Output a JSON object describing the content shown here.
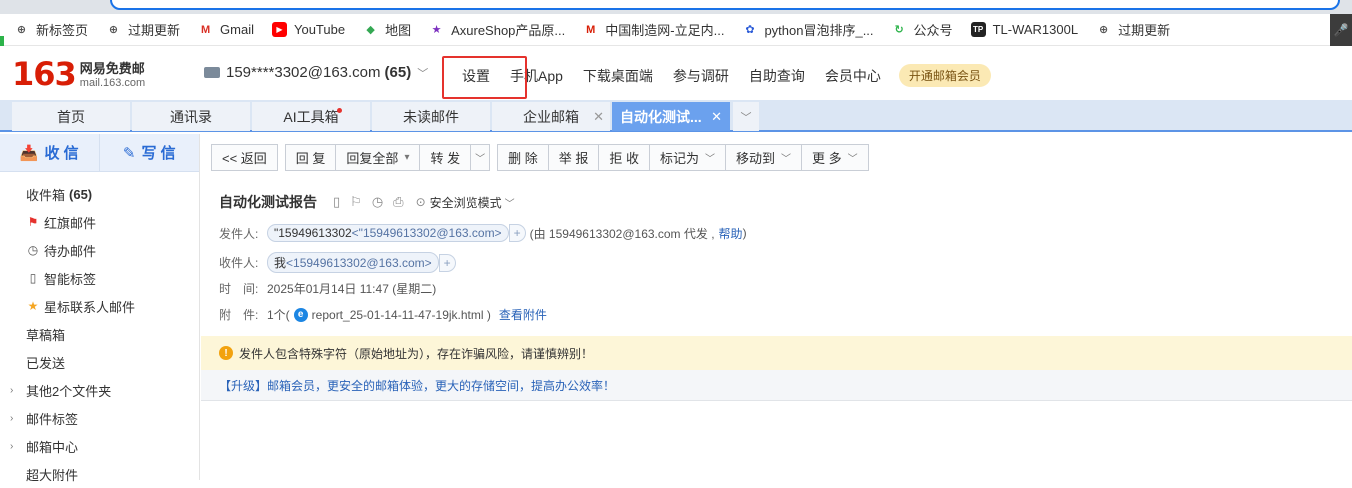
{
  "browser": {
    "bookmarks": [
      {
        "label": "新标签页",
        "icon": "globe-icon",
        "color": "#555555"
      },
      {
        "label": "过期更新",
        "icon": "globe-icon",
        "color": "#555555"
      },
      {
        "label": "Gmail",
        "icon": "gmail-icon",
        "color": "#d93025"
      },
      {
        "label": "YouTube",
        "icon": "youtube-icon",
        "color": "#ff0000"
      },
      {
        "label": "地图",
        "icon": "maps-icon",
        "color": "#34a853"
      },
      {
        "label": "AxureShop产品原...",
        "icon": "star-icon",
        "color": "#7b2fbf"
      },
      {
        "label": "中国制造网-立足内...",
        "icon": "mic-logo-icon",
        "color": "#d81e06"
      },
      {
        "label": "python冒泡排序_...",
        "icon": "paw-icon",
        "color": "#2b5bd7"
      },
      {
        "label": "公众号",
        "icon": "swirl-icon",
        "color": "#2cb34a"
      },
      {
        "label": "TL-WAR1300L",
        "icon": "tp-link-icon",
        "color": "#222222"
      },
      {
        "label": "过期更新",
        "icon": "globe-icon",
        "color": "#555555"
      }
    ]
  },
  "header": {
    "logo_num": "163",
    "logo_title": "网易免费邮",
    "logo_domain": "mail.163.com",
    "account": "159****3302@163.com",
    "account_count": "(65)",
    "nav": [
      "设置",
      "手机App",
      "下载桌面端",
      "参与调研",
      "自助查询",
      "会员中心"
    ],
    "vip": "开通邮箱会员",
    "highlight_color": "#e5322d"
  },
  "tabs": [
    {
      "label": "首页"
    },
    {
      "label": "通讯录"
    },
    {
      "label": "AI工具箱"
    },
    {
      "label": "未读邮件"
    },
    {
      "label": "企业邮箱"
    },
    {
      "label": "自动化测试..."
    }
  ],
  "sidebar": {
    "receive": "收 信",
    "write": "写 信",
    "folders": [
      {
        "label": "收件箱",
        "count": "(65)",
        "icon": ""
      },
      {
        "label": "红旗邮件",
        "count": "",
        "icon": "red-flag-icon"
      },
      {
        "label": "待办邮件",
        "count": "",
        "icon": "clock-icon"
      },
      {
        "label": "智能标签",
        "count": "",
        "icon": "tag-icon"
      },
      {
        "label": "星标联系人邮件",
        "count": "",
        "icon": "star-icon"
      },
      {
        "label": "草稿箱",
        "count": "",
        "icon": ""
      },
      {
        "label": "已发送",
        "count": "",
        "icon": ""
      },
      {
        "label": "其他2个文件夹",
        "count": "",
        "icon": "expand"
      },
      {
        "label": "邮件标签",
        "count": "",
        "icon": "expand"
      },
      {
        "label": "邮箱中心",
        "count": "",
        "icon": "expand"
      },
      {
        "label": "超大附件",
        "count": "",
        "icon": ""
      }
    ]
  },
  "toolbar": {
    "back": "<< 返回",
    "reply": "回 复",
    "reply_all": "回复全部",
    "forward": "转 发",
    "delete": "删 除",
    "report": "举 报",
    "reject": "拒 收",
    "mark_as": "标记为",
    "move_to": "移动到",
    "more": "更 多"
  },
  "mail": {
    "subject": "自动化测试报告",
    "safe_mode": "安全浏览模式",
    "from_label": "发件人:",
    "from_name": "\"15949613302",
    "from_email": "<\"15949613302@163.com>",
    "from_via_prefix": "(由 15949613302@163.com 代发 ,",
    "from_help": "帮助",
    "from_via_suffix": ")",
    "to_label": "收件人:",
    "to_name": "我",
    "to_email": "<15949613302@163.com>",
    "time_label": "时　间:",
    "time_value": "2025年01月14日 11:47 (星期二)",
    "attach_label": "附　件:",
    "attach_count": "1个(",
    "attach_name": "report_25-01-14-11-47-19jk.html )",
    "attach_view": "查看附件",
    "warning": "发件人包含特殊字符（原始地址为），存在诈骗风险，请谨慎辨别！",
    "upgrade": "【升级】邮箱会员，更安全的邮箱体验，更大的存储空间，提高办公效率！"
  }
}
